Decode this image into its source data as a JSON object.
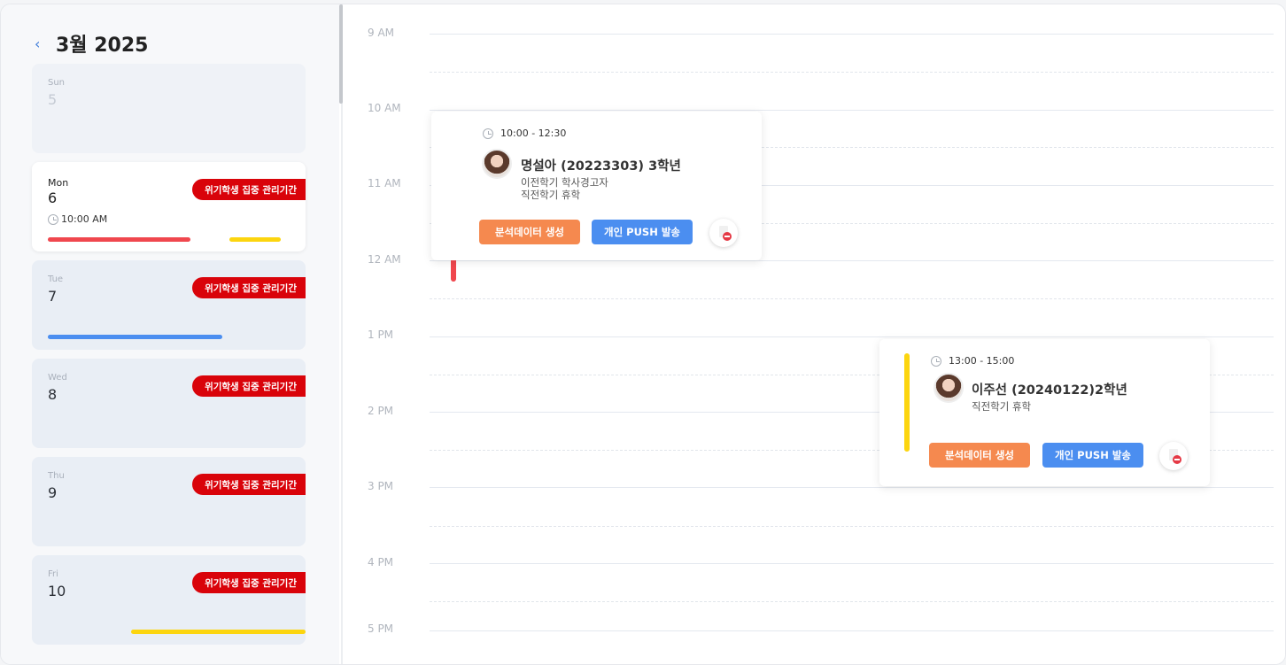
{
  "header": {
    "back_icon": "‹",
    "month": "3월 2025"
  },
  "days": [
    {
      "name": "Sun",
      "num": "5"
    },
    {
      "name": "Mon",
      "num": "6",
      "badge": "위기학생 집중 관리기간",
      "time": "10:00 AM"
    },
    {
      "name": "Tue",
      "num": "7",
      "badge": "위기학생 집중 관리기간"
    },
    {
      "name": "Wed",
      "num": "8",
      "badge": "위기학생 집중 관리기간"
    },
    {
      "name": "Thu",
      "num": "9",
      "badge": "위기학생 집중 관리기간"
    },
    {
      "name": "Fri",
      "num": "10",
      "badge": "위기학생 집중 관리기간"
    }
  ],
  "hours": [
    "9 AM",
    "10 AM",
    "11 AM",
    "12 AM",
    "1 PM",
    "2 PM",
    "3 PM",
    "4 PM",
    "5 PM"
  ],
  "events": [
    {
      "time": "10:00 - 12:30",
      "name": "명설아 (20223303) 3학년",
      "detail1": "이전학기  학사경고자",
      "detail2": "직전학기  휴학",
      "btn_analysis": "분석데이터 생성",
      "btn_push": "개인 PUSH 발송"
    },
    {
      "time": "13:00 - 15:00",
      "name": "이주선 (20240122)2학년",
      "detail1": "직전학기  휴학",
      "btn_analysis": "분석데이터 생성",
      "btn_push": "개인 PUSH 발송"
    }
  ],
  "colors": {
    "red": "#f0474e",
    "yellow": "#fcd50f",
    "blue": "#4b8ef0",
    "badge": "#d9030a",
    "orange": "#f5894f"
  }
}
